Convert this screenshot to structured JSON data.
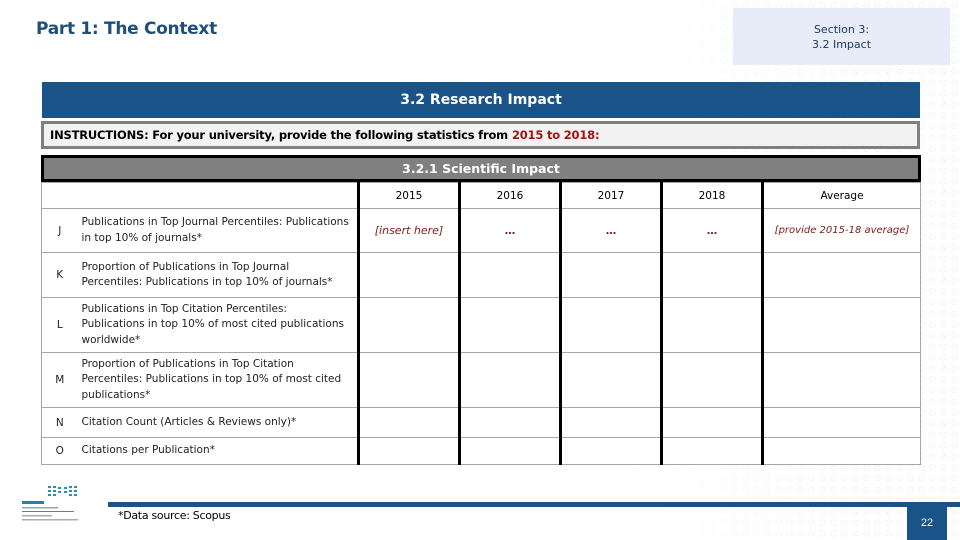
{
  "header": {
    "title": "Part 1: The Context",
    "section_line1": "Section 3:",
    "section_line2": "3.2 Impact"
  },
  "banner": "3.2 Research Impact",
  "instructions": {
    "text": "INSTRUCTIONS: For your university, provide the following statistics from",
    "highlight": "2015 to 2018:"
  },
  "subsection": "3.2.1 Scientific Impact",
  "table": {
    "columns": [
      "2015",
      "2016",
      "2017",
      "2018",
      "Average"
    ],
    "rows": [
      {
        "code": "J",
        "label": "Publications in Top Journal Percentiles: Publications in top 10% of journals*",
        "values": [
          "[insert here]",
          "…",
          "…",
          "…"
        ],
        "average": "[provide 2015-18 average]"
      },
      {
        "code": "K",
        "label": "Proportion of Publications in Top Journal Percentiles: Publications in top 10% of journals*",
        "values": [
          "",
          "",
          "",
          ""
        ],
        "average": ""
      },
      {
        "code": "L",
        "label": "Publications in Top Citation Percentiles: Publications in top 10% of most cited publications worldwide*",
        "values": [
          "",
          "",
          "",
          ""
        ],
        "average": ""
      },
      {
        "code": "M",
        "label": "Proportion of Publications in Top Citation Percentiles: Publications in top 10% of most cited publications*",
        "values": [
          "",
          "",
          "",
          ""
        ],
        "average": ""
      },
      {
        "code": "N",
        "label": "Citation Count (Articles & Reviews only)*",
        "values": [
          "",
          "",
          "",
          ""
        ],
        "average": ""
      },
      {
        "code": "O",
        "label": "Citations per Publication*",
        "values": [
          "",
          "",
          "",
          ""
        ],
        "average": ""
      }
    ]
  },
  "footer": {
    "footnote": "*Data source: Scopus",
    "page_number": "22",
    "logo": "ministry-of-education-logo"
  },
  "colors": {
    "brand_blue": "#1a5388",
    "title_blue": "#1f4e79",
    "highlight_red": "#a01414",
    "placeholder_red": "#7b1c1c",
    "section_bg": "#e7ecf8",
    "subbanner_gray": "#808080"
  }
}
